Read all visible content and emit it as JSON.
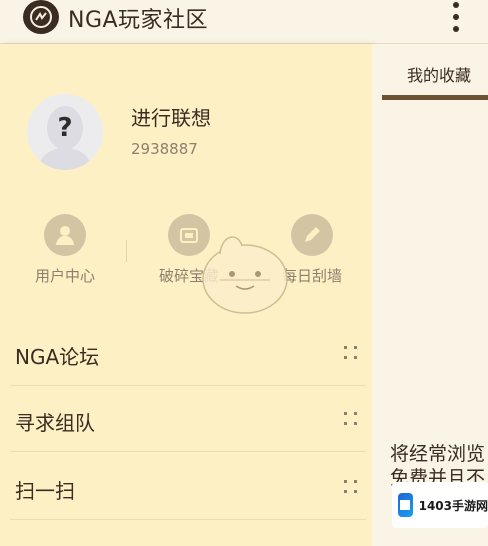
{
  "header": {
    "app_title": "NGA玩家社区",
    "logo_icon": "nga-logo-icon",
    "menu_icon": "more-vert-icon"
  },
  "drawer": {
    "profile": {
      "username": "进行联想",
      "user_id": "2938887",
      "avatar_icon": "default-avatar-icon"
    },
    "quick_actions": [
      {
        "label": "用户中心",
        "icon": "user-icon"
      },
      {
        "label": "破碎宝藏",
        "icon": "treasure-icon"
      },
      {
        "label": "每日刮墙",
        "icon": "pencil-icon"
      }
    ],
    "menu_items": [
      {
        "label": "NGA论坛",
        "icon": "drag-handle-icon"
      },
      {
        "label": "寻求组队",
        "icon": "drag-handle-icon"
      },
      {
        "label": "扫一扫",
        "icon": "drag-handle-icon"
      }
    ]
  },
  "right_panel": {
    "tab_label": "我的收藏",
    "hint_line1": "将经常浏览",
    "hint_line2": "免费并且不"
  },
  "watermark": {
    "text": "1403手游网"
  },
  "colors": {
    "drawer_bg": "#fdf0c4",
    "topbar_bg": "#f9f4e6",
    "text_dark": "#3a2c22",
    "text_muted": "#8d7f6e",
    "tab_underline": "#6b5334",
    "icon_bg": "#d3c4a4"
  }
}
